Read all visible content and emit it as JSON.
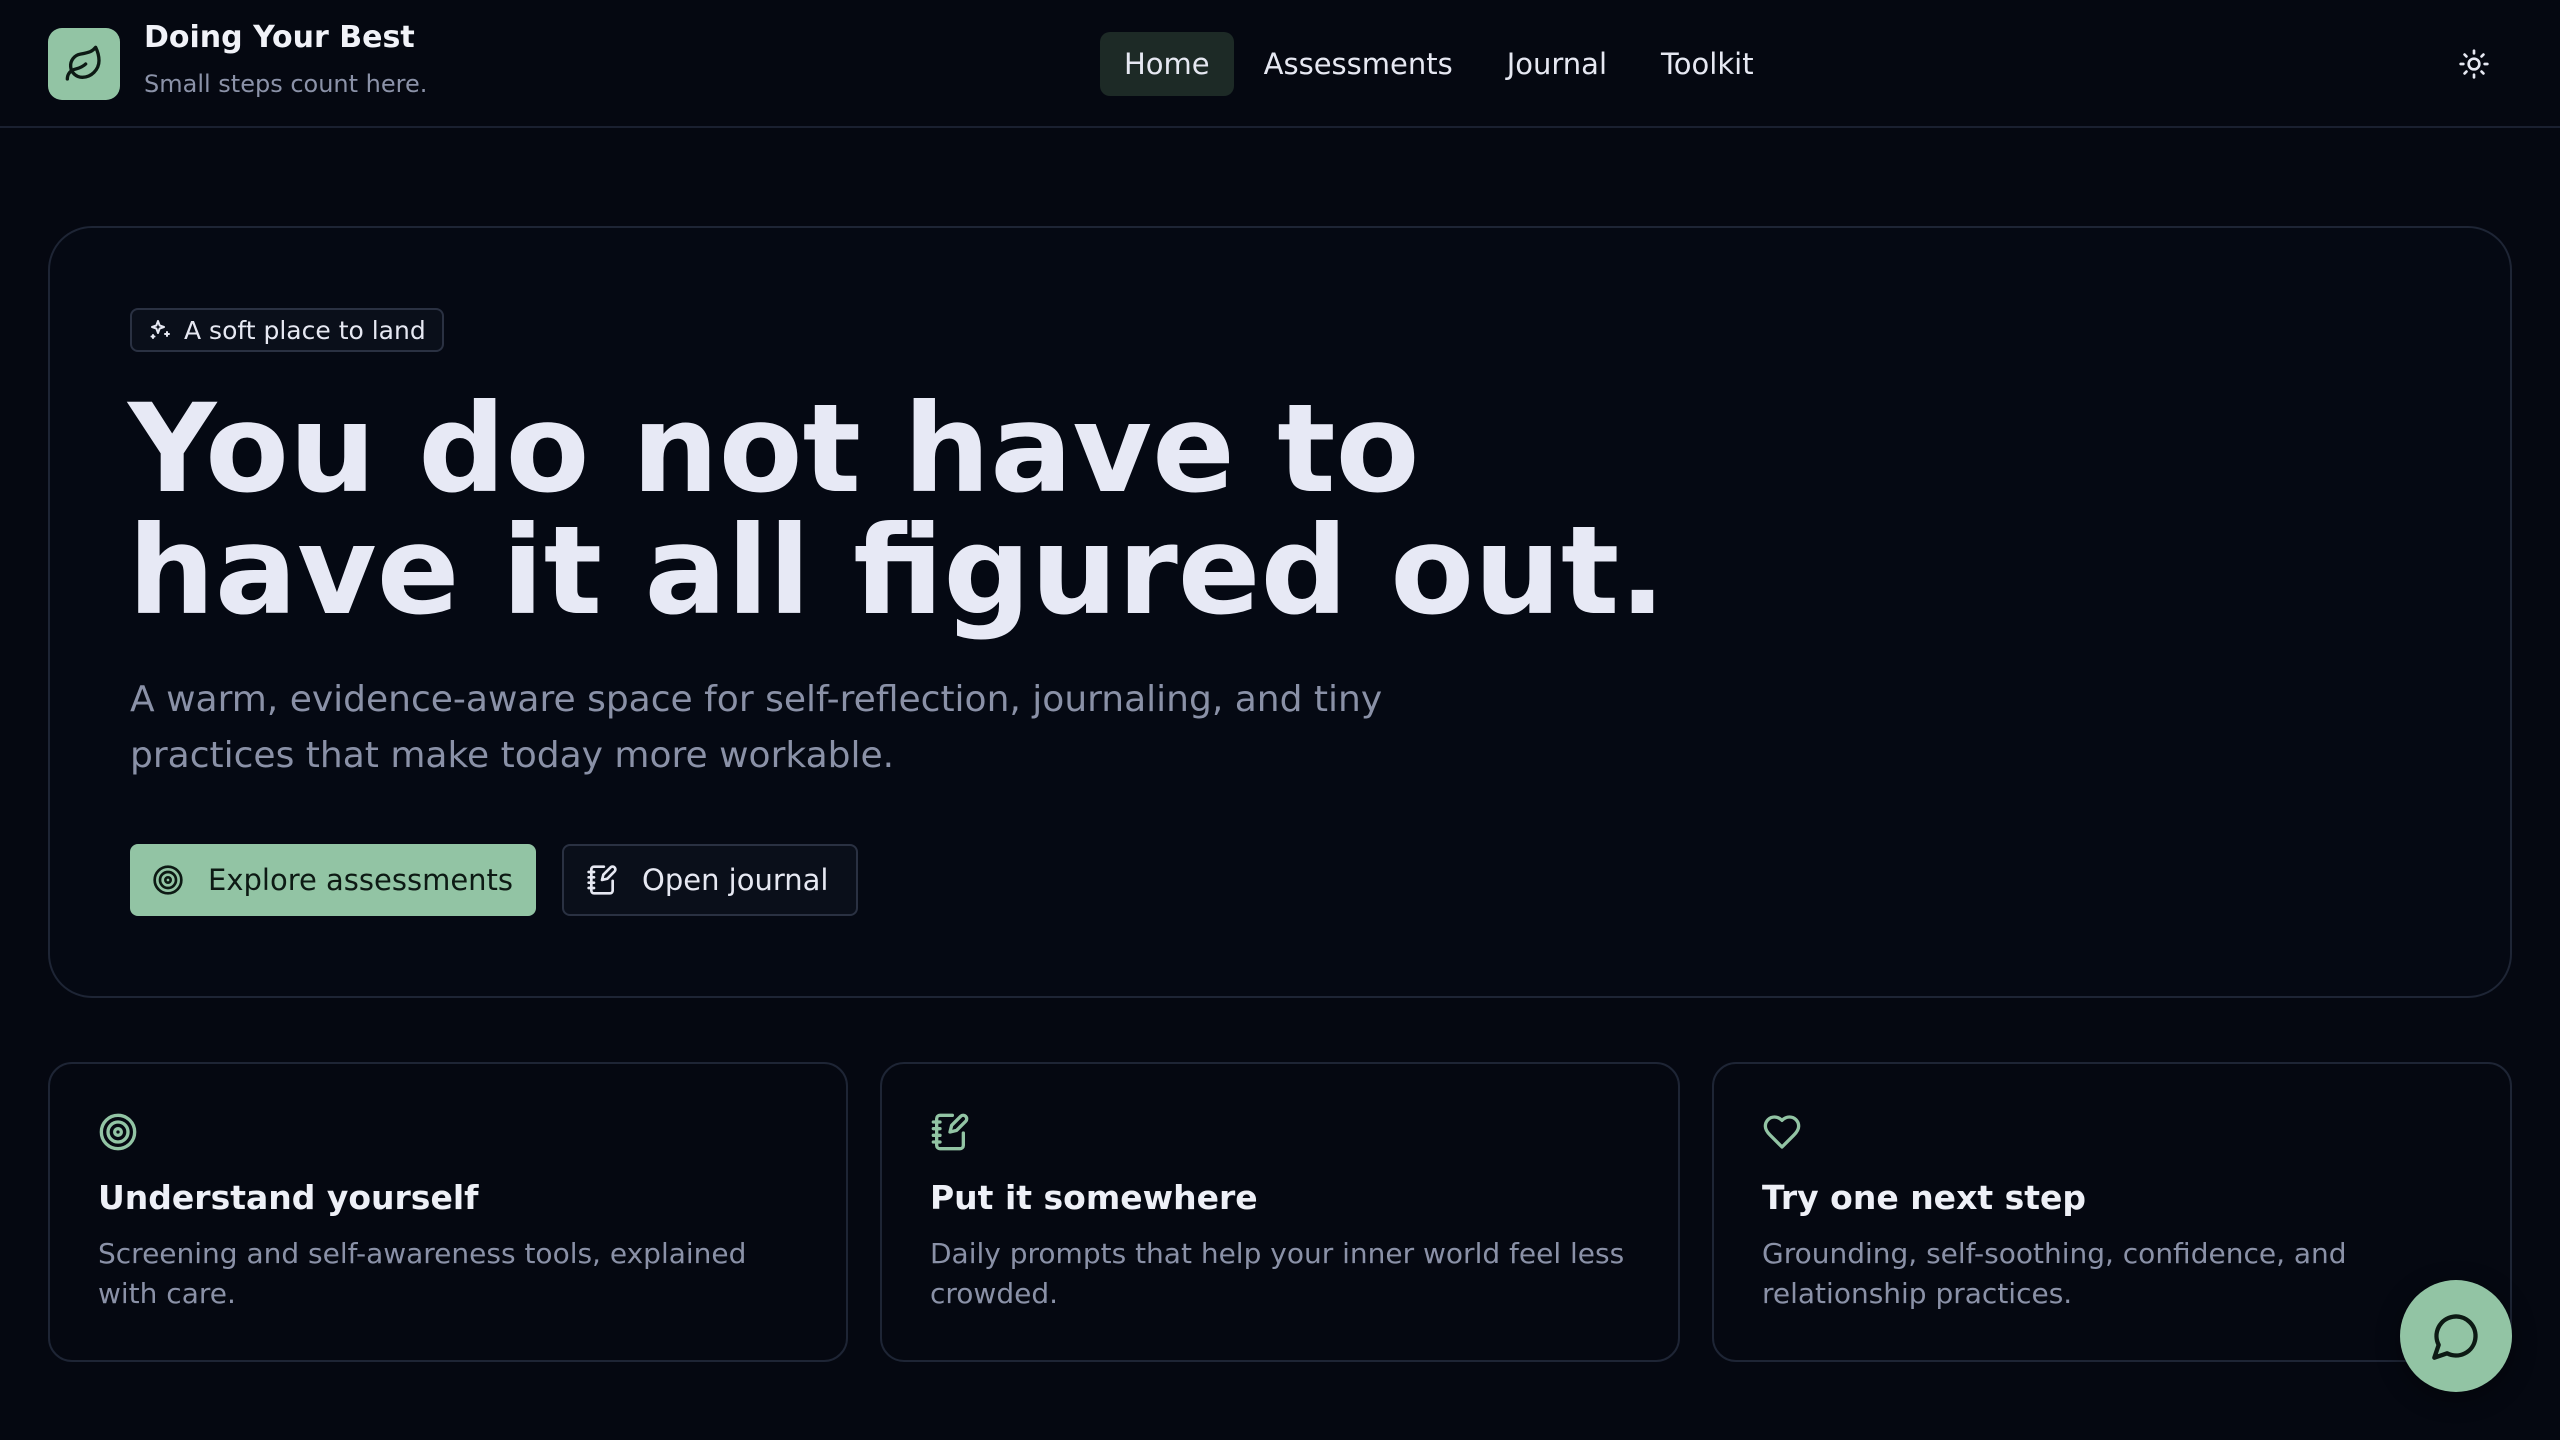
{
  "brand": {
    "title": "Doing Your Best",
    "tagline": "Small steps count here.",
    "logo_icon": "leaf-icon"
  },
  "nav": {
    "items": [
      {
        "label": "Home",
        "active": true
      },
      {
        "label": "Assessments",
        "active": false
      },
      {
        "label": "Journal",
        "active": false
      },
      {
        "label": "Toolkit",
        "active": false
      }
    ],
    "theme_toggle_icon": "sun-icon"
  },
  "hero": {
    "badge": {
      "label": "A soft place to land",
      "icon": "sparkles-icon"
    },
    "title_lines": [
      "You do not have to",
      "have it all figured out."
    ],
    "subtitle": "A warm, evidence-aware space for self-reflection, journaling, and tiny practices that make today more workable.",
    "primary_button": {
      "label": "Explore assessments",
      "icon": "target-icon"
    },
    "secondary_button": {
      "label": "Open journal",
      "icon": "notebook-pen-icon"
    }
  },
  "cards": [
    {
      "icon": "target-icon",
      "title": "Understand yourself",
      "description": "Screening and self-awareness tools, explained with care."
    },
    {
      "icon": "notebook-pen-icon",
      "title": "Put it somewhere",
      "description": "Daily prompts that help your inner world feel less crowded."
    },
    {
      "icon": "heart-icon",
      "title": "Try one next step",
      "description": "Grounding, self-soothing, confidence, and relationship practices."
    }
  ],
  "chat_button": {
    "icon": "chat-bubble-icon"
  },
  "colors": {
    "background": "#050811",
    "accent": "#92c4a4",
    "text_primary": "#e6e8f2",
    "text_muted": "#8a91a7",
    "border": "#1e2535",
    "nav_active_bg": "#1d2a26"
  }
}
